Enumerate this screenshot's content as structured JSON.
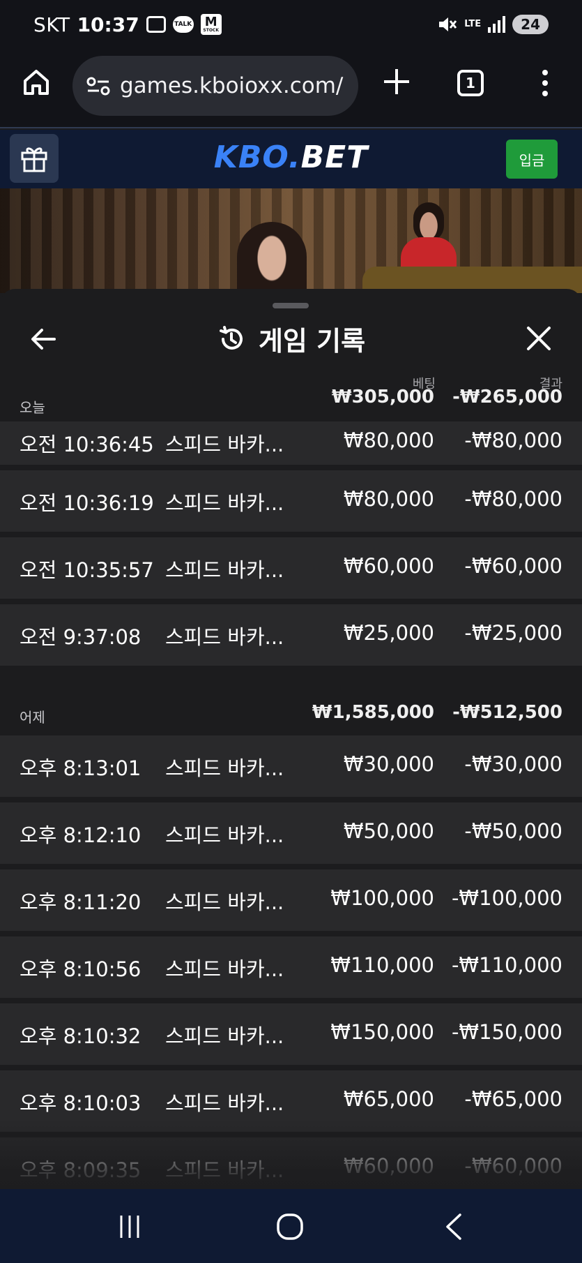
{
  "status_bar": {
    "carrier": "SKT",
    "time": "10:37",
    "talk_icon_text": "TALK",
    "m_icon_text": "M",
    "m_icon_sub": "STOCK",
    "network": "LTE",
    "battery": "24"
  },
  "browser": {
    "url": "games.kboioxx.com/",
    "tab_count": "1"
  },
  "site": {
    "brand_part1": "KBO.",
    "brand_part2": "BET",
    "deposit_label": "입금"
  },
  "sheet": {
    "title": "게임 기록",
    "bet_column_label": "베팅",
    "result_column_label": "결과",
    "groups": [
      {
        "label": "오늘",
        "total_bet": "₩305,000",
        "total_result": "-₩265,000",
        "rows": [
          {
            "time": "오전 10:36:45",
            "game": "스피드 바카...",
            "bet": "₩80,000",
            "result": "-₩80,000"
          },
          {
            "time": "오전 10:36:19",
            "game": "스피드 바카...",
            "bet": "₩80,000",
            "result": "-₩80,000"
          },
          {
            "time": "오전 10:35:57",
            "game": "스피드 바카...",
            "bet": "₩60,000",
            "result": "-₩60,000"
          },
          {
            "time": "오전 9:37:08",
            "game": "스피드 바카...",
            "bet": "₩25,000",
            "result": "-₩25,000"
          }
        ]
      },
      {
        "label": "어제",
        "total_bet": "₩1,585,000",
        "total_result": "-₩512,500",
        "rows": [
          {
            "time": "오후 8:13:01",
            "game": "스피드 바카...",
            "bet": "₩30,000",
            "result": "-₩30,000"
          },
          {
            "time": "오후 8:12:10",
            "game": "스피드 바카...",
            "bet": "₩50,000",
            "result": "-₩50,000"
          },
          {
            "time": "오후 8:11:20",
            "game": "스피드 바카...",
            "bet": "₩100,000",
            "result": "-₩100,000"
          },
          {
            "time": "오후 8:10:56",
            "game": "스피드 바카...",
            "bet": "₩110,000",
            "result": "-₩110,000"
          },
          {
            "time": "오후 8:10:32",
            "game": "스피드 바카...",
            "bet": "₩150,000",
            "result": "-₩150,000"
          },
          {
            "time": "오후 8:10:03",
            "game": "스피드 바카...",
            "bet": "₩65,000",
            "result": "-₩65,000"
          },
          {
            "time": "오후 8:09:35",
            "game": "스피드 바카...",
            "bet": "₩60,000",
            "result": "-₩60,000"
          }
        ]
      }
    ]
  },
  "colors": {
    "accent_brand": "#3a82f7",
    "deposit_green": "#1f9b3a",
    "sheet_bg": "#1c1c1e",
    "row_bg": "#29292b",
    "header_bg": "#0f1a33"
  }
}
